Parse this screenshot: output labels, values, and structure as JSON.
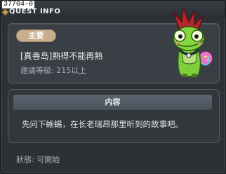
{
  "window": {
    "quest_id": "37704-0",
    "title": "QUEST INFO"
  },
  "quest": {
    "badge": "主要",
    "name": "[真香岛]熟得不能再熟",
    "level_requirement": "建議等級: 215以上",
    "mascot_icon": "green-chameleon-mascot-icon"
  },
  "content": {
    "header": "内容",
    "text": "先问下蜥蜴，在长老瑞昂那里听到的故事吧。"
  },
  "status": {
    "text": "狀態: 可開始"
  },
  "colors": {
    "window_bg": "#2d3136",
    "badge_bg": "#c9ae8c",
    "header_bg": "#55606a"
  }
}
